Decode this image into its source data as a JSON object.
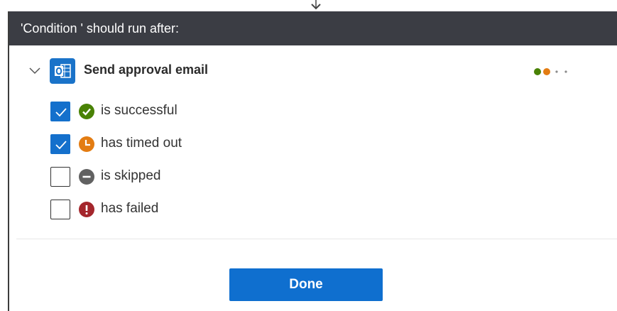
{
  "dialog": {
    "title": "'Condition ' should run after:"
  },
  "action": {
    "title": "Send approval email",
    "icon": "outlook-icon",
    "expanded": true,
    "status_dot_colors": [
      "#498205",
      "#e37c12",
      "#8a8a8a",
      "#8a8a8a"
    ]
  },
  "options": [
    {
      "label": "is successful",
      "checked": true,
      "icon": "check-circle-icon",
      "color": "#498205"
    },
    {
      "label": "has timed out",
      "checked": true,
      "icon": "clock-icon",
      "color": "#e37c12"
    },
    {
      "label": "is skipped",
      "checked": false,
      "icon": "minus-circle-icon",
      "color": "#616161"
    },
    {
      "label": "has failed",
      "checked": false,
      "icon": "exclamation-circle-icon",
      "color": "#a4262c"
    }
  ],
  "footer": {
    "done_label": "Done",
    "accent": "#0f6fcf"
  }
}
